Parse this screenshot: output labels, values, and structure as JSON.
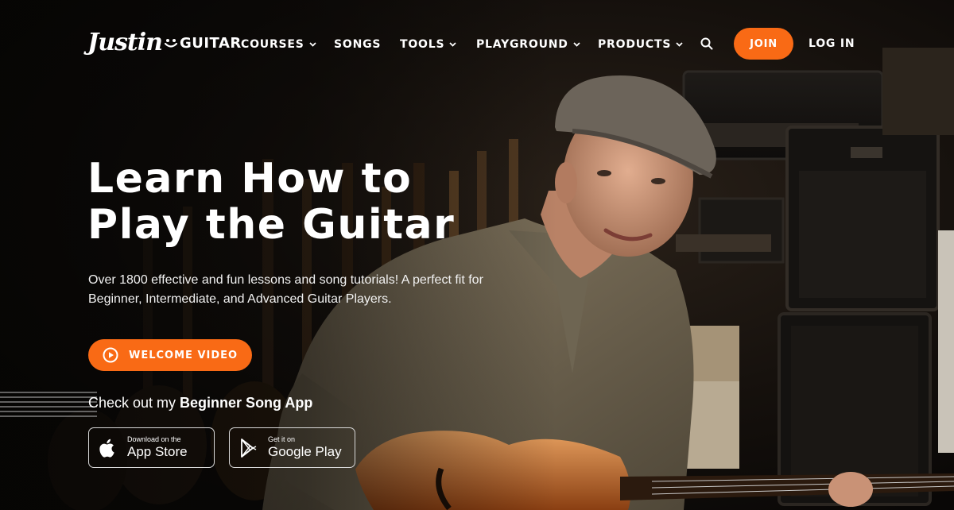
{
  "brand": {
    "logo_script": "Justin",
    "logo_word": "GUITAR"
  },
  "nav": {
    "items": [
      {
        "label": "COURSES",
        "has_dropdown": true
      },
      {
        "label": "SONGS",
        "has_dropdown": false
      },
      {
        "label": "TOOLS",
        "has_dropdown": true
      },
      {
        "label": "PLAYGROUND",
        "has_dropdown": true
      },
      {
        "label": "PRODUCTS",
        "has_dropdown": true
      }
    ],
    "search_icon": "search-icon",
    "join_label": "JOIN",
    "login_label": "LOG IN"
  },
  "hero": {
    "headline_line1": "Learn How to",
    "headline_line2": "Play the Guitar",
    "subcopy": "Over 1800 effective and fun lessons and song tutorials! A perfect fit for Beginner, Intermediate, and Advanced Guitar Players.",
    "welcome_video_label": "WELCOME VIDEO",
    "app_intro": "Check out my ",
    "app_name": "Beginner Song App"
  },
  "stores": {
    "apple": {
      "small": "Download on the",
      "big": "App Store",
      "icon": "apple-icon"
    },
    "google": {
      "small": "Get it on",
      "big": "Google Play",
      "icon": "google-play-icon"
    }
  },
  "colors": {
    "accent": "#f96a15",
    "background": "#0b0908",
    "text": "#ffffff"
  }
}
